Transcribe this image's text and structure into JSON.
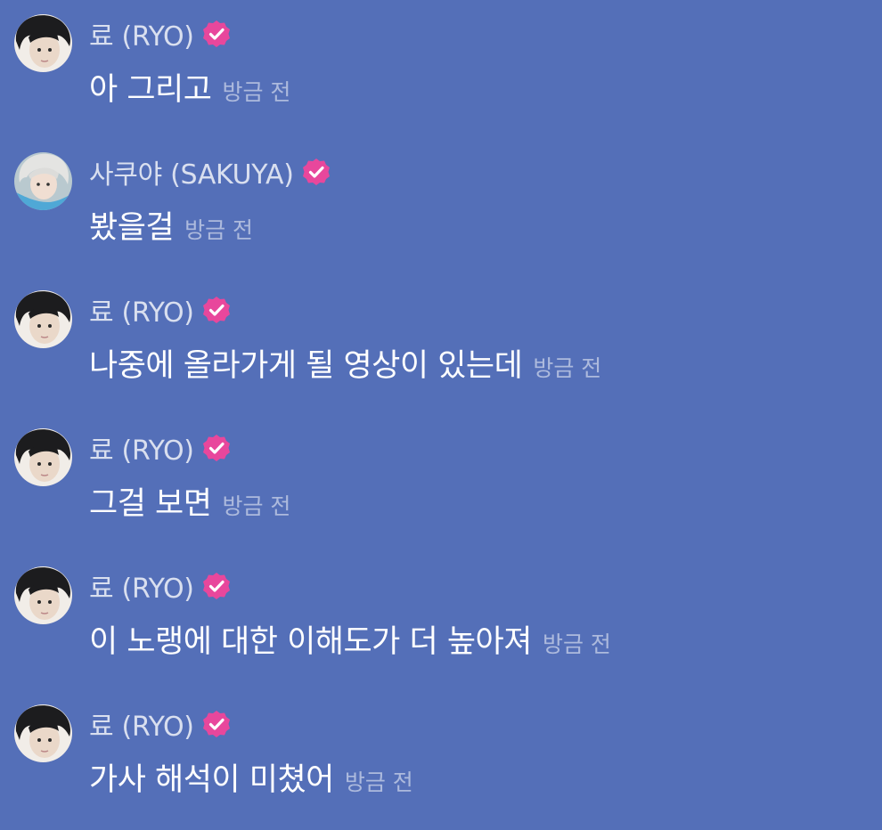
{
  "messages": [
    {
      "author": "료 (RYO)",
      "text": "아 그리고",
      "time": "방금 전",
      "avatar": "ryo-avatar",
      "verified": true
    },
    {
      "author": "사쿠야 (SAKUYA)",
      "text": "봤을걸",
      "time": "방금 전",
      "avatar": "sakuya-avatar",
      "verified": true
    },
    {
      "author": "료 (RYO)",
      "text": "나중에 올라가게 될 영상이 있는데",
      "time": "방금 전",
      "avatar": "ryo-avatar",
      "verified": true
    },
    {
      "author": "료 (RYO)",
      "text": "그걸 보면",
      "time": "방금 전",
      "avatar": "ryo-avatar",
      "verified": true
    },
    {
      "author": "료 (RYO)",
      "text": "이 노랭에 대한 이해도가 더 높아져",
      "time": "방금 전",
      "avatar": "ryo-avatar",
      "verified": true
    },
    {
      "author": "료 (RYO)",
      "text": "가사 해석이 미쳤어",
      "time": "방금 전",
      "avatar": "ryo-avatar",
      "verified": true
    }
  ],
  "colors": {
    "background": "#546fb8",
    "badge": "#e8479c",
    "text": "#ffffff"
  }
}
